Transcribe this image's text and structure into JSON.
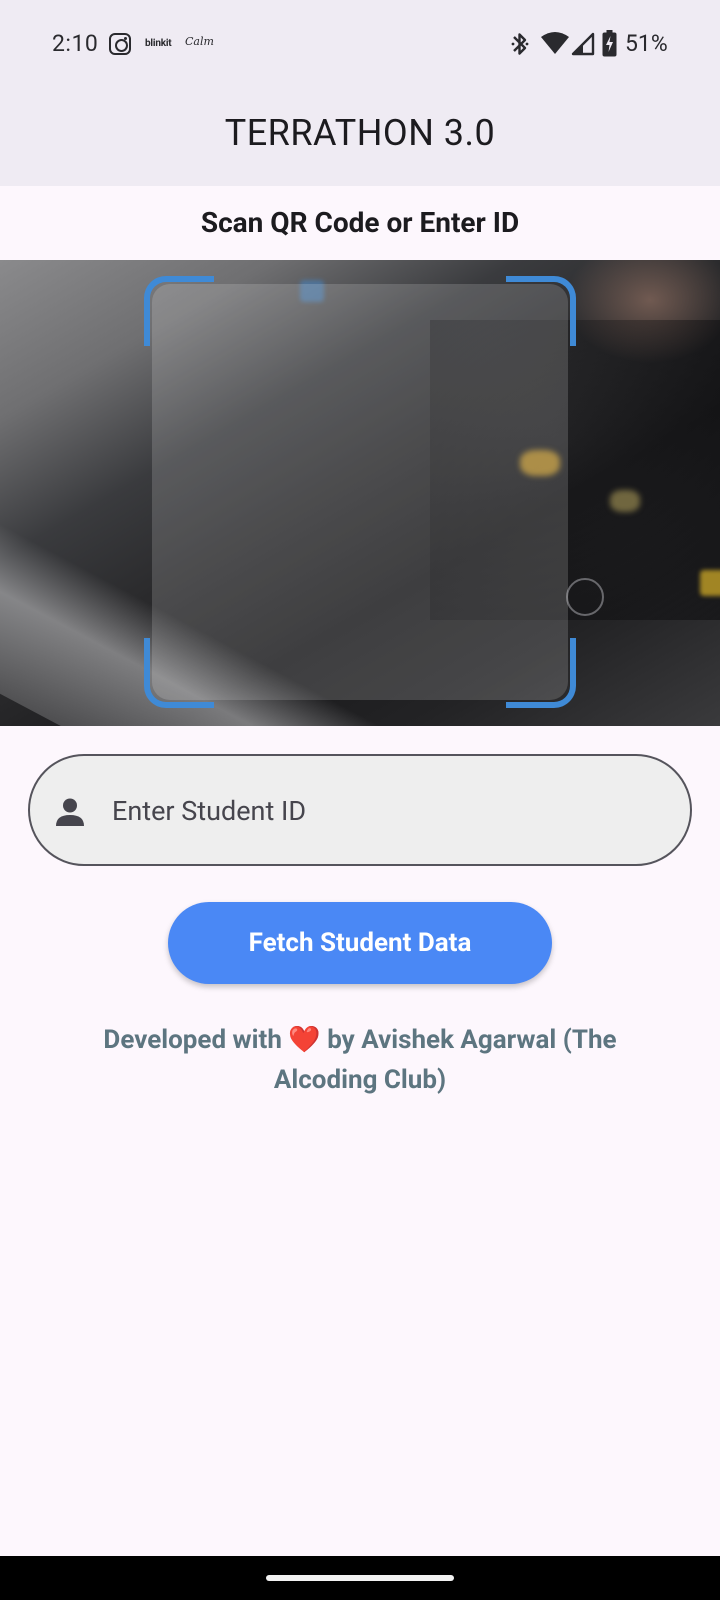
{
  "status_bar": {
    "time": "2:10",
    "notif_icons": [
      "instagram-icon",
      "blinkit-icon",
      "calm-icon"
    ],
    "blinkit_label": "blinkit",
    "calm_label": "Calm",
    "battery": "51%"
  },
  "app_bar": {
    "title": "TERRATHON 3.0"
  },
  "scanner": {
    "title": "Scan QR Code or Enter ID",
    "frame_color": "#3f8ad6"
  },
  "student_id": {
    "placeholder": "Enter Student ID",
    "value": ""
  },
  "fetch_button": {
    "label": "Fetch Student Data",
    "color": "#4a88f5"
  },
  "footer": {
    "prefix": "Developed with ",
    "heart": "❤️",
    "suffix": " by Avishek Agarwal (The Alcoding Club)"
  }
}
